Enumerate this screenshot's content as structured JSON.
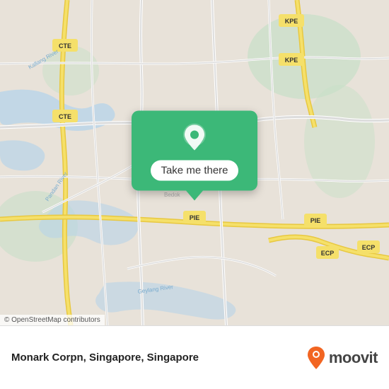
{
  "map": {
    "attribution": "© OpenStreetMap contributors",
    "background_color": "#e8e2d9"
  },
  "popup": {
    "label": "Take me there",
    "pin_color": "#ffffff",
    "background_color": "#3cb878"
  },
  "info_bar": {
    "location_name": "Monark Corpn, Singapore, Singapore",
    "location_parts": [
      "Monark Corpn,",
      "Singapore, Singapore"
    ],
    "logo_text": "moovit"
  },
  "icons": {
    "map_pin": "map-pin-icon",
    "moovit_pin": "moovit-pin-icon"
  }
}
